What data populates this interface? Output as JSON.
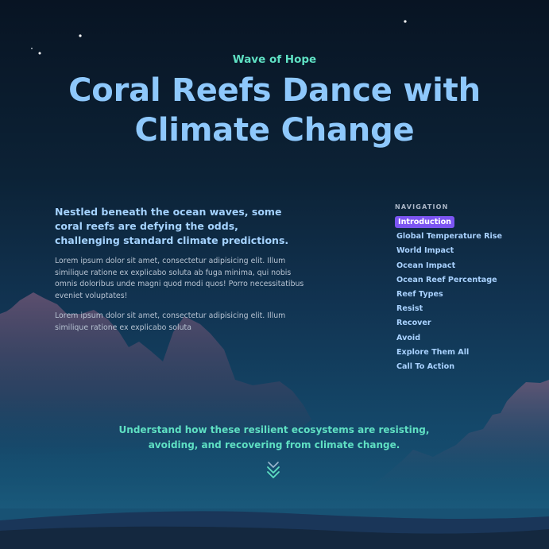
{
  "hero": {
    "eyebrow": "Wave of Hope",
    "title": "Coral Reefs Dance with Climate Change"
  },
  "intro": {
    "lead": "Nestled beneath the ocean waves, some coral reefs are defying the odds, challenging standard climate predictions.",
    "paragraphs": [
      "Lorem ipsum dolor sit amet, consectetur adipisicing elit. Illum similique ratione ex explicabo soluta ab fuga minima, qui nobis omnis doloribus unde magni quod modi quos! Porro necessitatibus eveniet voluptates!",
      "Lorem ipsum dolor sit amet, consectetur adipisicing elit. Illum similique ratione ex explicabo soluta"
    ]
  },
  "navigation": {
    "title": "NAVIGATION",
    "active": "Introduction",
    "items": [
      "Introduction",
      "Global Temperature Rise",
      "World Impact",
      "Ocean Impact",
      "Ocean Reef Percentage",
      "Reef Types",
      "Resist",
      "Recover",
      "Avoid",
      "Explore Them All",
      "Call To Action"
    ]
  },
  "cta": {
    "text": "Understand how these resilient ecosystems are resisting, avoiding, and recovering from climate change.",
    "scroll_icon": "double-chevron-down-icon"
  },
  "colors": {
    "accent_teal": "#5fe0c3",
    "title_blue": "#8ec8fc",
    "active_purple": "#7c55f2",
    "sky_top": "#081423",
    "sea_bottom": "#1a5678"
  }
}
